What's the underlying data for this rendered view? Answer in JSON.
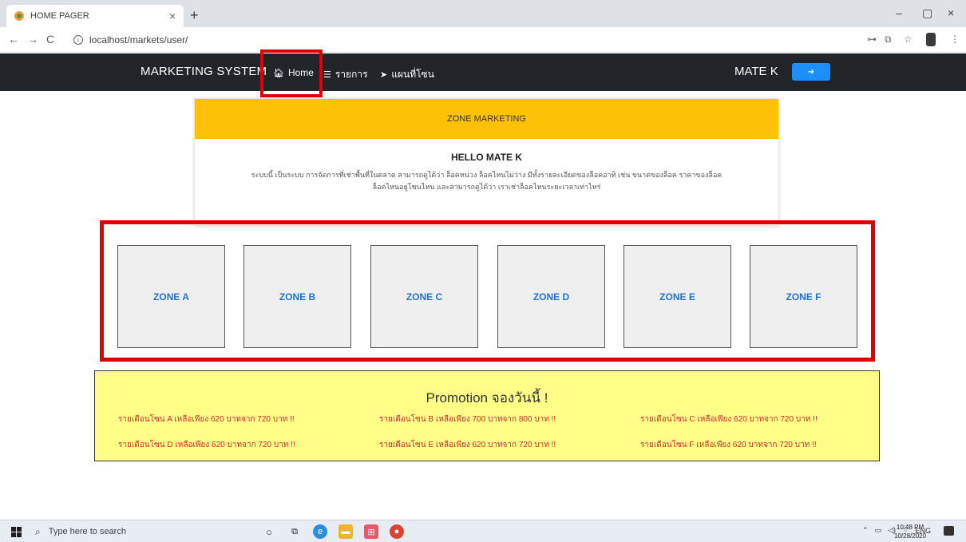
{
  "browser": {
    "tab_title": "HOME PAGER",
    "tab_close": "×",
    "new_tab": "+",
    "url": "localhost/markets/user/",
    "window_controls": {
      "minimize": "–",
      "maximize": "▢",
      "close": "×"
    }
  },
  "navbar": {
    "brand": "MARKETING SYSTEM",
    "links": [
      {
        "icon": "home-icon",
        "label": "Home"
      },
      {
        "icon": "list-icon",
        "label": "รายการ"
      },
      {
        "icon": "location-arrow-icon",
        "label": "แผนที่โซน"
      }
    ],
    "user": "MATE K",
    "logout_icon": "sign-out-icon"
  },
  "card": {
    "header": "ZONE MARKETING",
    "title": "HELLO MATE K",
    "text_line1": "ระบบนี้ เป็นระบบ การจัดการที่เช่าพื้นที่ในตลาด สามารถดูได้ว่า ล็อคหน่วง ล็อคไหนไม่ว่าง มีทั้งรายละเอียดของล็อคอาทิ เช่น ขนาดของล็อค ราคาของล็อค",
    "text_line2": "ล็อคไหนอยู่โซนไหน และสามารถดูได้ว่า เราเช่าล็อคไหนระยะเวลาเท่าไหร่"
  },
  "zones": [
    "ZONE A",
    "ZONE B",
    "ZONE C",
    "ZONE D",
    "ZONE E",
    "ZONE F"
  ],
  "promotion": {
    "title": "Promotion จองวันนี้ !",
    "items": [
      "รายเดือนโซน A เหลือเพียง 620 บาทจาก 720 บาท !!",
      "รายเดือนโซน B เหลือเพียง 700 บาทจาก 800 บาท !!",
      "รายเดือนโซน C เหลือเพียง 620 บาทจาก 720 บาท !!",
      "รายเดือนโซน D เหลือเพียง 620 บาทจาก 720 บาท !!",
      "รายเดือนโซน E เหลือเพียง 620 บาทจาก 720 บาท !!",
      "รายเดือนโซน F เหลือเพียง 620 บาทจาก 720 บาท !!"
    ]
  },
  "taskbar": {
    "search_placeholder": "Type here to search",
    "language": "ENG",
    "time": "10:48 PM",
    "date": "10/28/2020"
  },
  "colors": {
    "navbar_bg": "#212529",
    "card_header": "#ffc107",
    "zone_text": "#1e73d8",
    "promo_bg": "#ffff88",
    "promo_text": "#cc2b2b",
    "highlight": "#e00000",
    "logout_btn": "#1e8fff"
  }
}
